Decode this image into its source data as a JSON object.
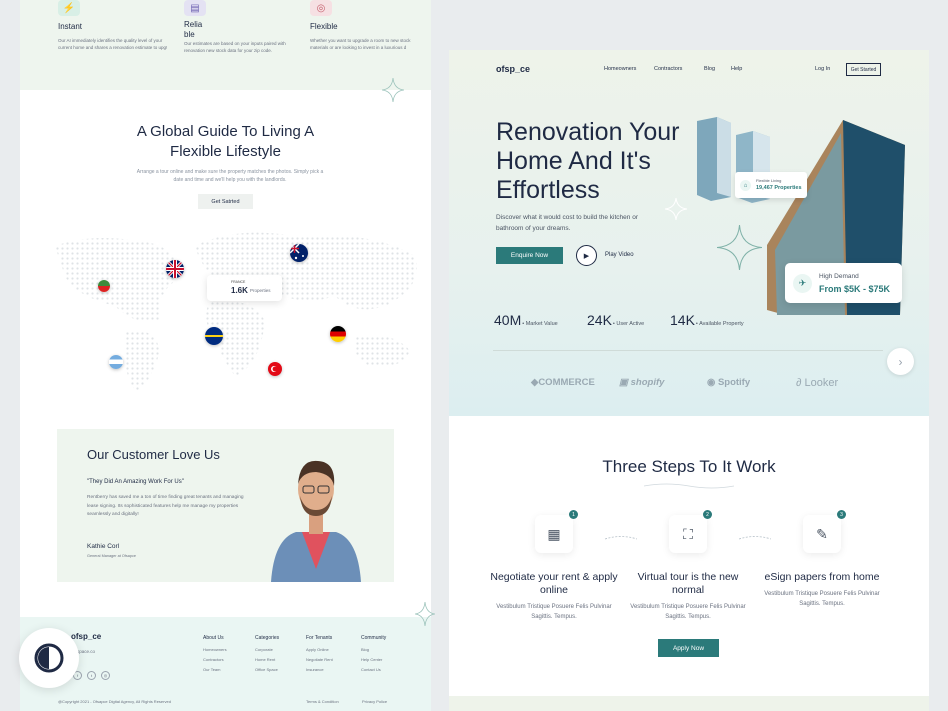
{
  "features": [
    {
      "title": "Instant",
      "text": "Our AI immediately identifies the quality level of your current home and shares a renovation estimate to upg!",
      "icon": "lightning-icon"
    },
    {
      "title": "Relia ble",
      "text": "Our estimates are based on your inputs paired with renovation new stock data for your zip code.",
      "icon": "document-icon"
    },
    {
      "title": "Flexible",
      "text": "Whether you want to upgrade a room to new stock materials or are looking to invest in a luxurious d",
      "icon": "target-icon"
    }
  ],
  "guide": {
    "title_line1": "A Global Guide To Living A",
    "title_line2": "Flexible Lifestyle",
    "subtitle": "Arrange a tour online and make sure the property matches the photos. Simply pick a date and time and we'll help you with the landlords.",
    "button": "Get Satrted"
  },
  "map_tooltip": {
    "country": "FRANCE",
    "value": "1.6K",
    "unit": "Properties"
  },
  "testimonial": {
    "heading": "Our Customer Love Us",
    "quote": "\"They Did An Amazing Work For Us\"",
    "body": "Rentberry has saved me a ton of time finding great tenants and managing lease signing. Its sophisticated features help me manage my properties seamlessly and digitally!",
    "name": "Kathie Corl",
    "role": "General Manager at Ofsapce"
  },
  "footer": {
    "logo": "ofsp_ce",
    "email": "ofsspace.co",
    "columns": [
      {
        "heading": "About Us",
        "items": [
          "Homeowners",
          "Contractors",
          "Our Team"
        ]
      },
      {
        "heading": "Categories",
        "items": [
          "Corporate",
          "Home Rent",
          "Office Space"
        ]
      },
      {
        "heading": "For Tenants",
        "items": [
          "Apply Online",
          "Negotiate Rent",
          "Insurance"
        ]
      },
      {
        "heading": "Community",
        "items": [
          "Blog",
          "Help Center",
          "Contact Us"
        ]
      }
    ],
    "copyright": "@Copyright 2021 - Ofsapce Digital Agency, All Rights Reserved",
    "terms": "Terms & Condition",
    "privacy": "Privacy Police"
  },
  "nav": {
    "logo": "ofsp_ce",
    "links": [
      "Homeowners",
      "Contractors",
      "Blog",
      "Help"
    ],
    "login": "Log In",
    "get_started": "Get Started"
  },
  "hero": {
    "title": "Renovation Your Home And It's Effortless",
    "subtitle": "Discover what it would cost to build the kitchen or bathroom of your dreams.",
    "enquire": "Enquire Now",
    "play": "Play Video",
    "flexible_card": {
      "label": "Flexible Living",
      "value": "19,467 Properties"
    },
    "demand_card": {
      "label": "High Demand",
      "value": "From $5K - $75K"
    }
  },
  "stats": [
    {
      "value": "40M",
      "label": "• Market Value"
    },
    {
      "value": "24K",
      "label": "• User Active"
    },
    {
      "value": "14K",
      "label": "• Available Property"
    }
  ],
  "brands": [
    "COMMERCE",
    "shopify",
    "Spotify",
    "Looker"
  ],
  "steps": {
    "title": "Three Steps To It Work",
    "items": [
      {
        "num": "1",
        "title": "Negotiate your rent & apply online",
        "text": "Vestibulum Tristique Posuere Felis Pulvinar Sagittis. Tempus."
      },
      {
        "num": "2",
        "title": "Virtual tour is the new normal",
        "text": "Vestibulum Tristique Posuere Felis Pulvinar Sagittis. Tempus."
      },
      {
        "num": "3",
        "title": "eSign papers from home",
        "text": "Vestibulum Tristique Posuere Felis Pulvinar Sagittis. Tempus."
      }
    ],
    "apply": "Apply Now"
  },
  "colors": {
    "accent": "#2b7a7a",
    "navy": "#1f2a44"
  }
}
